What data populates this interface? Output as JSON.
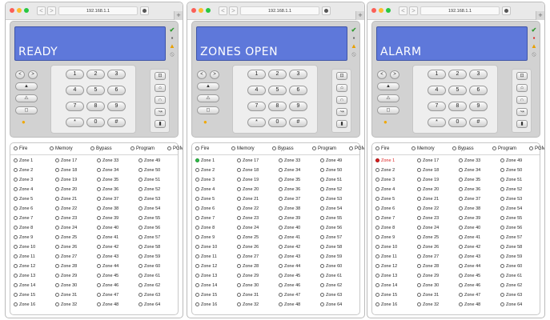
{
  "browser": {
    "url": "192.168.1.1",
    "back_icon": "<",
    "forward_icon": ">",
    "new_tab_icon": "+"
  },
  "windows": [
    {
      "lcd_text": "READY",
      "zone1_state": "normal",
      "lock_color": "grey"
    },
    {
      "lcd_text": "ZONES OPEN",
      "zone1_state": "open",
      "lock_color": "grey"
    },
    {
      "lcd_text": "ALARM",
      "zone1_state": "alarm",
      "lock_color": "red"
    }
  ],
  "status_icons": [
    "check-icon",
    "lock-icon",
    "warning-icon",
    "disabled-icon"
  ],
  "status_glyphs": [
    "✔",
    "▪",
    "▲",
    "⦸"
  ],
  "keypad": {
    "keys": [
      "1",
      "2",
      "3",
      "4",
      "5",
      "6",
      "7",
      "8",
      "9",
      "*",
      "0",
      "#"
    ],
    "left_icons": [
      "fire-icon",
      "warning-icon",
      "shield-icon",
      "bulb-icon"
    ],
    "left_glyphs": [
      "▲",
      "⚠",
      "◻"
    ],
    "arrow_left": "<",
    "arrow_right": ">",
    "right_icons": [
      "arm-away-icon",
      "arm-home-icon",
      "chime-icon",
      "bypass-icon",
      "door-icon"
    ],
    "right_glyphs": [
      "⊡",
      "⌂",
      "∩",
      "↝",
      "▮"
    ]
  },
  "header_items": [
    "Fire",
    "Memory",
    "Bypass",
    "Program",
    "PGM"
  ],
  "zones": [
    "Zone 1",
    "Zone 2",
    "Zone 3",
    "Zone 4",
    "Zone 5",
    "Zone 6",
    "Zone 7",
    "Zone 8",
    "Zone 9",
    "Zone 10",
    "Zone 11",
    "Zone 12",
    "Zone 13",
    "Zone 14",
    "Zone 15",
    "Zone 16",
    "Zone 17",
    "Zone 18",
    "Zone 19",
    "Zone 20",
    "Zone 21",
    "Zone 22",
    "Zone 23",
    "Zone 24",
    "Zone 25",
    "Zone 26",
    "Zone 27",
    "Zone 28",
    "Zone 29",
    "Zone 30",
    "Zone 31",
    "Zone 32",
    "Zone 33",
    "Zone 34",
    "Zone 35",
    "Zone 36",
    "Zone 37",
    "Zone 38",
    "Zone 39",
    "Zone 40",
    "Zone 41",
    "Zone 42",
    "Zone 43",
    "Zone 44",
    "Zone 45",
    "Zone 46",
    "Zone 47",
    "Zone 48",
    "Zone 49",
    "Zone 50",
    "Zone 51",
    "Zone 52",
    "Zone 53",
    "Zone 54",
    "Zone 55",
    "Zone 56",
    "Zone 57",
    "Zone 58",
    "Zone 59",
    "Zone 60",
    "Zone 61",
    "Zone 62",
    "Zone 63",
    "Zone 64"
  ],
  "colors": {
    "lcd_bg": "#5e78da",
    "zone_open": "#2fc04a",
    "zone_alarm": "#e02020",
    "status_ok": "#2d9a2d",
    "status_warn": "#e8a000"
  }
}
